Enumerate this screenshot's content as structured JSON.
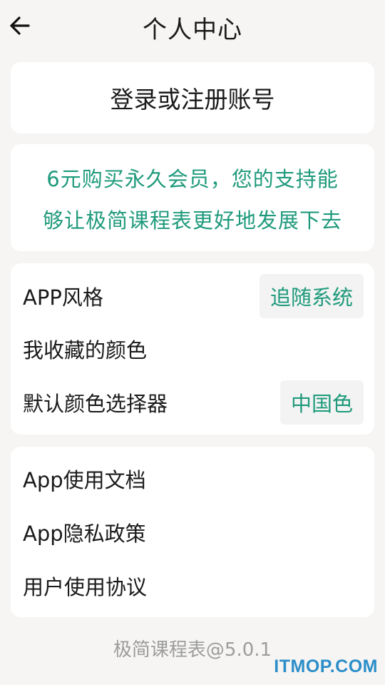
{
  "header": {
    "title": "个人中心",
    "back_icon": "arrow-left-icon"
  },
  "login": {
    "label": "登录或注册账号"
  },
  "vip": {
    "line1": "6元购买永久会员，您的支持能",
    "line2": "够让极简课程表更好地发展下去"
  },
  "settings": {
    "app_style_label": "APP风格",
    "app_style_value": "追随系统",
    "favorite_colors_label": "我收藏的颜色",
    "default_picker_label": "默认颜色选择器",
    "default_picker_value": "中国色"
  },
  "docs": {
    "app_docs_label": "App使用文档",
    "privacy_label": "App隐私政策",
    "agreement_label": "用户使用协议"
  },
  "footer": {
    "version": "极简课程表@5.0.1"
  },
  "watermark": {
    "text": "ITMOP.COM"
  },
  "colors": {
    "accent": "#1f9a7c",
    "background": "#f6f5f3",
    "card": "#ffffff",
    "watermark": "#2c8ec9"
  }
}
